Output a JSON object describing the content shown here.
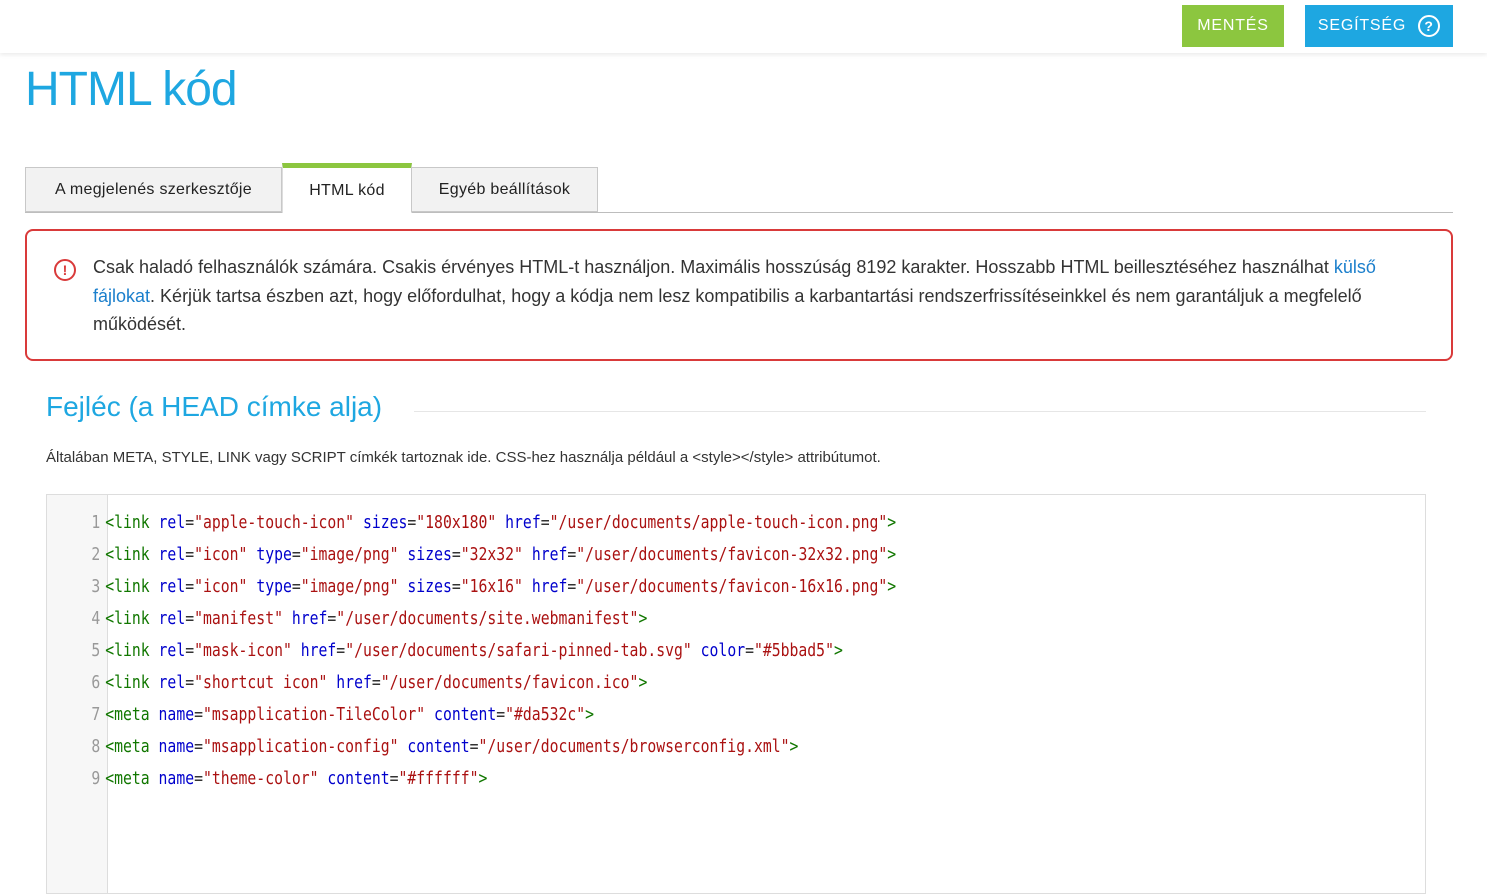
{
  "topbar": {
    "save_label": "MENTÉS",
    "help_label": "SEGÍTSÉG",
    "help_icon": "?",
    "colors": {
      "save": "#8cc63f",
      "help": "#1ea7e1"
    }
  },
  "page": {
    "title": "HTML kód"
  },
  "tabs": [
    {
      "label": "A megjelenés szerkesztője",
      "active": false
    },
    {
      "label": "HTML kód",
      "active": true
    },
    {
      "label": "Egyéb beállítások",
      "active": false
    }
  ],
  "alert": {
    "icon": "!",
    "text_before": "Csak haladó felhasználók számára. Csakis érvényes HTML-t használjon. Maximális hosszúság 8192 karakter. Hosszabb HTML beillesztéséhez használhat ",
    "link": "külső fájlokat",
    "text_after": ". Kérjük tartsa észben azt, hogy előfordulhat, hogy a kódja nem lesz kompatibilis a karbantartási rendszerfrissítéseinkkel és nem garantáljuk a megfelelő működését."
  },
  "section": {
    "title": "Fejléc (a HEAD címke alja)",
    "description": "Általában META, STYLE, LINK vagy SCRIPT címkék tartoznak ide. CSS-hez használja például a <style></style> attribútumot."
  },
  "editor": {
    "lines": [
      {
        "num": "1",
        "tag": "link",
        "attrs": [
          [
            "rel",
            "apple-touch-icon"
          ],
          [
            "sizes",
            "180x180"
          ],
          [
            "href",
            "/user/documents/apple-touch-icon.png"
          ]
        ]
      },
      {
        "num": "2",
        "tag": "link",
        "attrs": [
          [
            "rel",
            "icon"
          ],
          [
            "type",
            "image/png"
          ],
          [
            "sizes",
            "32x32"
          ],
          [
            "href",
            "/user/documents/favicon-32x32.png"
          ]
        ]
      },
      {
        "num": "3",
        "tag": "link",
        "attrs": [
          [
            "rel",
            "icon"
          ],
          [
            "type",
            "image/png"
          ],
          [
            "sizes",
            "16x16"
          ],
          [
            "href",
            "/user/documents/favicon-16x16.png"
          ]
        ]
      },
      {
        "num": "4",
        "tag": "link",
        "attrs": [
          [
            "rel",
            "manifest"
          ],
          [
            "href",
            "/user/documents/site.webmanifest"
          ]
        ]
      },
      {
        "num": "5",
        "tag": "link",
        "attrs": [
          [
            "rel",
            "mask-icon"
          ],
          [
            "href",
            "/user/documents/safari-pinned-tab.svg"
          ],
          [
            "color",
            "#5bbad5"
          ]
        ]
      },
      {
        "num": "6",
        "tag": "link",
        "attrs": [
          [
            "rel",
            "shortcut icon"
          ],
          [
            "href",
            "/user/documents/favicon.ico"
          ]
        ]
      },
      {
        "num": "7",
        "tag": "meta",
        "attrs": [
          [
            "name",
            "msapplication-TileColor"
          ],
          [
            "content",
            "#da532c"
          ]
        ]
      },
      {
        "num": "8",
        "tag": "meta",
        "attrs": [
          [
            "name",
            "msapplication-config"
          ],
          [
            "content",
            "/user/documents/browserconfig.xml"
          ]
        ]
      },
      {
        "num": "9",
        "tag": "meta",
        "attrs": [
          [
            "name",
            "theme-color"
          ],
          [
            "content",
            "#ffffff"
          ]
        ]
      }
    ]
  }
}
